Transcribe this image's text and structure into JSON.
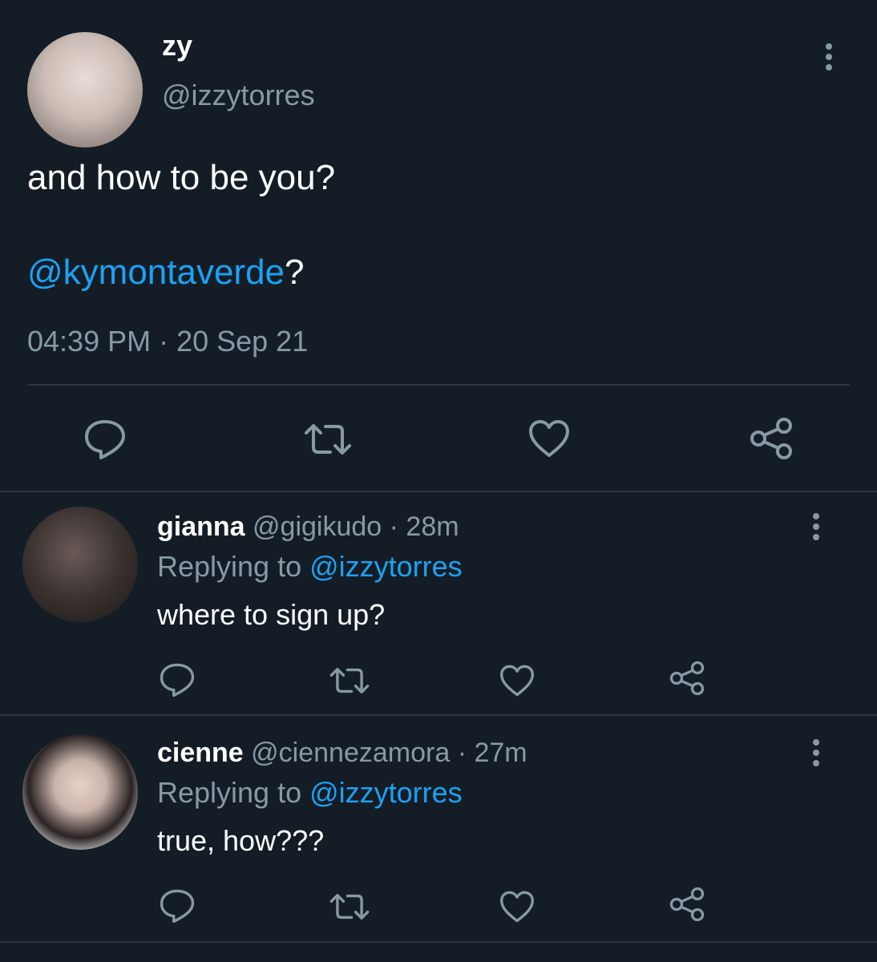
{
  "main_tweet": {
    "display_name": "zy",
    "handle": "@izzytorres",
    "text_line1": "and how to be you?",
    "mention": "@kymontaverde",
    "mention_suffix": "?",
    "timestamp": "04:39 PM · 20 Sep 21"
  },
  "replies": [
    {
      "display_name": "gianna",
      "handle": "@gigikudo",
      "time": " · 28m",
      "replying_label": "Replying to ",
      "replying_handle": "@izzytorres",
      "text": "where to sign up?"
    },
    {
      "display_name": "cienne",
      "handle": "@ciennezamora",
      "time": " · 27m",
      "replying_label": "Replying to ",
      "replying_handle": "@izzytorres",
      "text": "true, how???"
    }
  ],
  "icons": {
    "reply": "reply-icon",
    "retweet": "retweet-icon",
    "like": "heart-icon",
    "share": "share-icon",
    "menu": "more-vertical-icon"
  },
  "colors": {
    "background": "#141d26",
    "mention": "#1da1f2",
    "secondary_text": "#8899a6",
    "divider": "#2b3640"
  }
}
